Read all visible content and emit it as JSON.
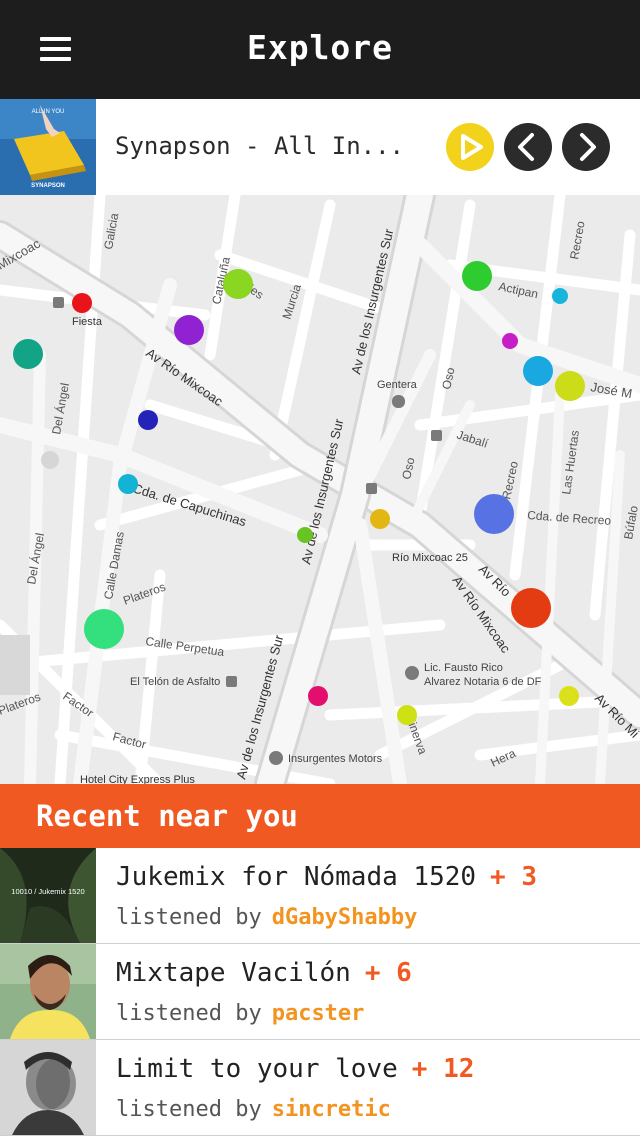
{
  "header": {
    "title": "Explore"
  },
  "player": {
    "track": "Synapson - All In...",
    "cover_text_top": "ALL IN YOU",
    "cover_text_bottom": "SYNAPSON",
    "colors": {
      "play": "#f2d21b",
      "nav": "#2b2b2b"
    }
  },
  "map": {
    "labels": {
      "galicia": "Galicia",
      "mixcoac": "Mixcoac",
      "fiesta": "Fiesta",
      "cataluna": "Cataluña",
      "andes": "Andes",
      "murcia": "Murcia",
      "av_ins_1": "Av de los Insurgentes Sur",
      "av_ins_2": "Av de los Insurgentes Sur",
      "av_ins_3": "Av de los Insurgentes Sur",
      "actipan": "Actipan",
      "recreo_1": "Recreo",
      "recreo_2": "Recreo",
      "oso_1": "Oso",
      "oso_2": "Oso",
      "genter": "Gentera",
      "jose": "José M",
      "jabali": "Jabalí",
      "las_huertas": "Las Huertas",
      "av_rio_1": "Av Río Mixcoac",
      "av_rio_2": "Av Río",
      "av_rio_3": "Av Río Mixcoac",
      "av_rio_4": "Av Río Mi",
      "del_angel_1": "Del Ángel",
      "del_angel_2": "Del Ángel",
      "capuchinas": "Cda. de Capuchinas",
      "cda_recreo": "Cda. de Recreo",
      "bufalo": "Búfalo",
      "rio_mixcoac_25": "Río Mixcoac 25",
      "calle_damas": "Calle Damas",
      "plateros_1": "Plateros",
      "plateros_2": "Plateros",
      "perpetua": "Calle Perpetua",
      "telon": "El Telón de Asfalto",
      "fausto_1": "Lic. Fausto Rico",
      "fausto_2": "Alvarez Notaria 6 de DF",
      "factor_1": "Factor",
      "factor_2": "Factor",
      "minerva": "Minerva",
      "hera": "Hera",
      "insurgentes_motors": "Insurgentes Motors",
      "hotel": "Hotel City Express Plus"
    },
    "markers": [
      {
        "name": "marker-red-fiesta",
        "color": "#e8141a"
      },
      {
        "name": "marker-purple",
        "color": "#9122d4"
      },
      {
        "name": "marker-lime-andes",
        "color": "#8bd621"
      },
      {
        "name": "marker-teal",
        "color": "#13a386"
      },
      {
        "name": "marker-navy",
        "color": "#2323b8"
      },
      {
        "name": "marker-cyan-capuchinas",
        "color": "#15b3d3"
      },
      {
        "name": "marker-green-actipan",
        "color": "#2ecc2e"
      },
      {
        "name": "marker-cyan-small",
        "color": "#17b4dc"
      },
      {
        "name": "marker-magenta-small",
        "color": "#c61fc7"
      },
      {
        "name": "marker-cyan-large",
        "color": "#1aa8e1"
      },
      {
        "name": "marker-yellowgreen",
        "color": "#ccdc19"
      },
      {
        "name": "marker-green-small",
        "color": "#67c422"
      },
      {
        "name": "marker-gold",
        "color": "#e2b713"
      },
      {
        "name": "marker-blue-large",
        "color": "#5672e3"
      },
      {
        "name": "marker-mint",
        "color": "#33e07d"
      },
      {
        "name": "marker-orange-red",
        "color": "#e33c12"
      },
      {
        "name": "marker-pink",
        "color": "#e30f6f"
      },
      {
        "name": "marker-yellow-1",
        "color": "#cde114"
      },
      {
        "name": "marker-yellow-2",
        "color": "#dce01b"
      }
    ]
  },
  "recent": {
    "title": "Recent near you",
    "listened_by": "listened by",
    "items": [
      {
        "title": "Jukemix for Nómada 1520",
        "plus": "+ 3",
        "user": "dGabyShabby",
        "thumb_text": "10010 / Jukemix 1520"
      },
      {
        "title": "Mixtape Vacilón",
        "plus": "+ 6",
        "user": "pacster"
      },
      {
        "title": "Limit to your love",
        "plus": "+ 12",
        "user": "sincretic"
      }
    ]
  },
  "colors": {
    "accent": "#f05a22",
    "user": "#f39320",
    "topbar": "#1d1d1d"
  }
}
